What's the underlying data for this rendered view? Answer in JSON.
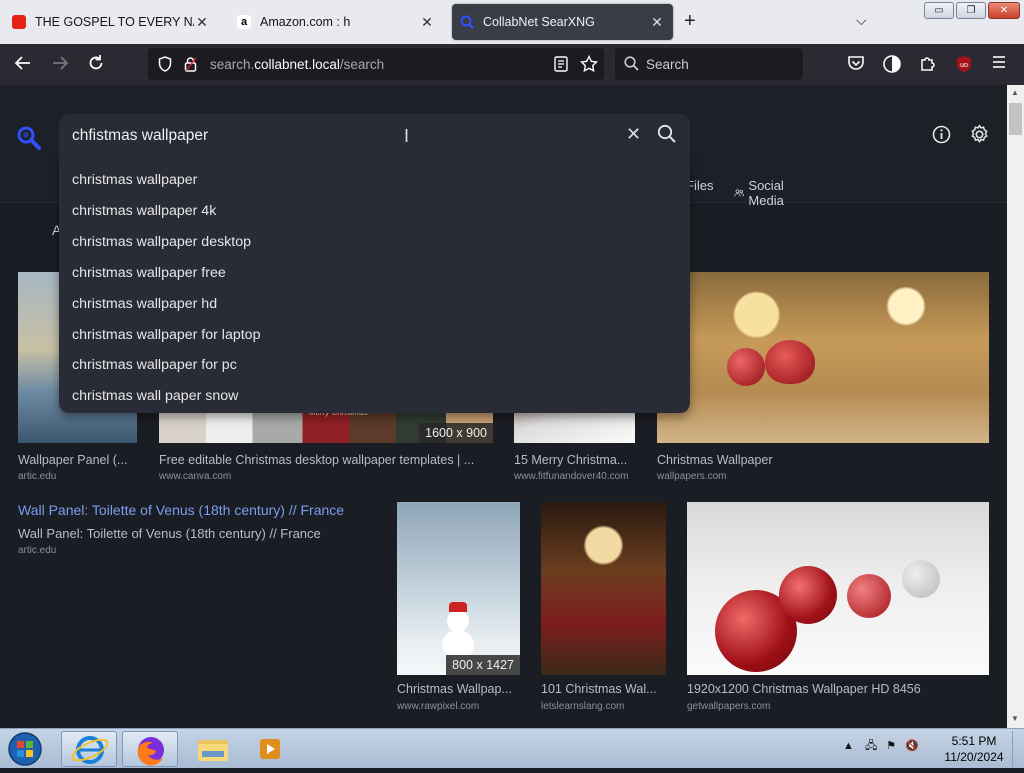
{
  "browser": {
    "tabs": [
      {
        "title": "THE GOSPEL TO EVERY NATION",
        "active": false
      },
      {
        "title": "Amazon.com : h",
        "active": false
      },
      {
        "title": "CollabNet SearXNG",
        "active": true
      }
    ],
    "url_prefix": "search.",
    "url_host": "collabnet.local",
    "url_path": "/search",
    "search_placeholder": "Search"
  },
  "search": {
    "query": "chfistmas wallpaper",
    "suggestions": [
      "christmas wallpaper",
      "christmas wallpaper 4k",
      "christmas wallpaper desktop",
      "christmas wallpaper free",
      "christmas wallpaper hd",
      "christmas wallpaper for laptop",
      "christmas wallpaper for pc",
      "christmas wall paper snow"
    ]
  },
  "categories": {
    "files": "Files",
    "social": "Social Media",
    "partial_all": "A"
  },
  "results": [
    {
      "title": "Wallpaper Panel (...",
      "url": "artic.edu"
    },
    {
      "title": "Free editable Christmas desktop wallpaper templates | ...",
      "url": "www.canva.com",
      "dims": "1600 x 900",
      "tile_text": "Merry Christmas"
    },
    {
      "title": "15 Merry Christma...",
      "url": "www.fitfunandover40.com"
    },
    {
      "title": "Christmas Wallpaper",
      "url": "wallpapers.com"
    },
    {
      "title": "Christmas Wallpap...",
      "url": "www.rawpixel.com",
      "dims": "800 x 1427"
    },
    {
      "title": "101 Christmas Wal...",
      "url": "letslearnslang.com"
    },
    {
      "title": "1920x1200 Christmas Wallpaper HD 8456",
      "url": "getwallpapers.com"
    }
  ],
  "link_result": {
    "title": "Wall Panel: Toilette of Venus (18th century) // France",
    "desc": "Wall Panel: Toilette of Venus (18th century) // France",
    "url": "artic.edu"
  },
  "taskbar": {
    "time": "5:51 PM",
    "date": "11/20/2024"
  },
  "colors": {
    "accent": "#3050ff",
    "page_bg": "#1b1d24",
    "link": "#7a9ef0"
  }
}
